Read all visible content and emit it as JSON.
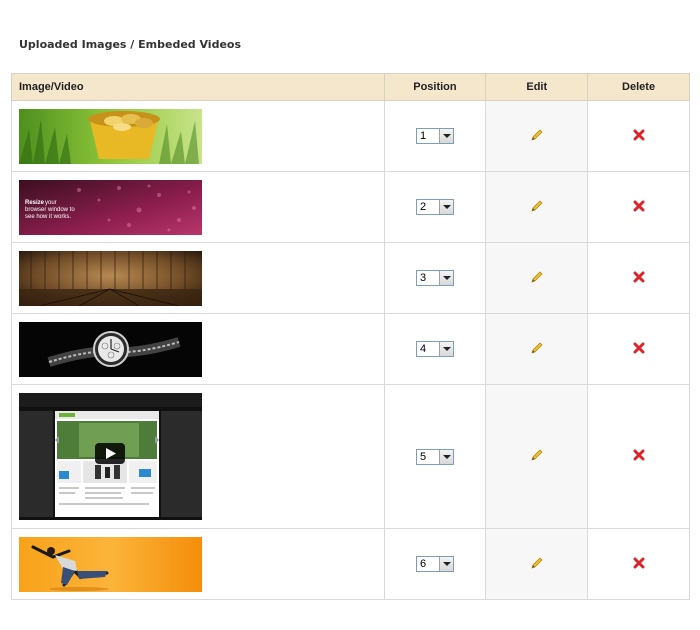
{
  "section": {
    "title": "Uploaded Images / Embeded Videos"
  },
  "table": {
    "headers": {
      "image": "Image/Video",
      "position": "Position",
      "edit": "Edit",
      "delete": "Delete"
    },
    "rows": [
      {
        "position": "1",
        "thumbnail": "coins-grass-image"
      },
      {
        "position": "2",
        "thumbnail": "pink-water-drops-image",
        "overlay_text_bold": "Resize",
        "overlay_text_1": " your",
        "overlay_text_2": "browser window to",
        "overlay_text_3": "see how it works."
      },
      {
        "position": "3",
        "thumbnail": "wooden-wall-floor-image"
      },
      {
        "position": "4",
        "thumbnail": "wristwatch-image"
      },
      {
        "position": "5",
        "thumbnail": "embedded-video-thumbnail",
        "play": "play-icon"
      },
      {
        "position": "6",
        "thumbnail": "jumping-man-orange-image"
      }
    ]
  },
  "icons": {
    "edit": "pencil-icon",
    "delete": "red-x-icon"
  },
  "colors": {
    "header_bg": "#f5e7cc",
    "edit_col_bg": "#f7f7f7",
    "delete_red": "#d9262c",
    "pencil_yellow": "#f2c12e"
  }
}
